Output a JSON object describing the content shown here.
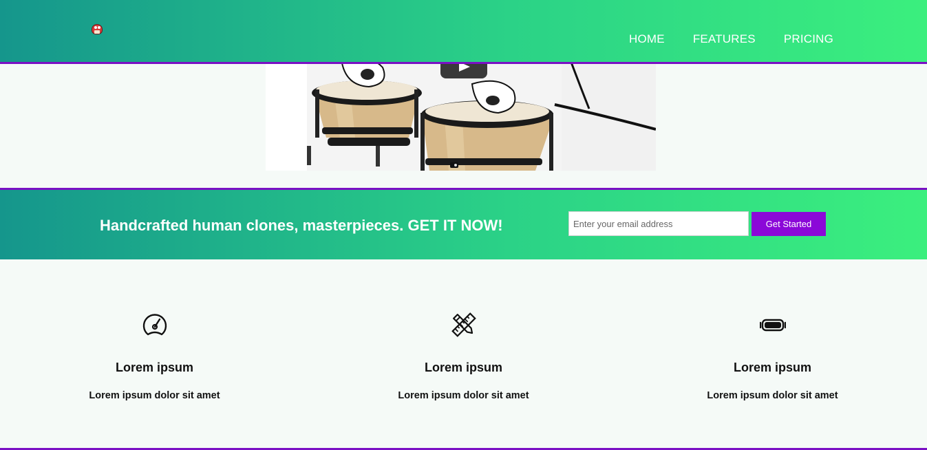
{
  "header": {
    "logo_icon": "mushroom-logo-icon",
    "nav": [
      {
        "label": "HOME"
      },
      {
        "label": "FEATURES"
      },
      {
        "label": "PRICING"
      }
    ]
  },
  "video": {
    "play_icon": "play-icon",
    "content": "bongo-drums-image"
  },
  "cta": {
    "headline": "Handcrafted human clones, masterpieces. GET IT NOW!",
    "email_placeholder": "Enter your email address",
    "button_label": "Get Started"
  },
  "features": [
    {
      "icon": "speedometer-icon",
      "title": "Lorem ipsum",
      "text": "Lorem ipsum dolor sit amet"
    },
    {
      "icon": "ruler-pencil-icon",
      "title": "Lorem ipsum",
      "text": "Lorem ipsum dolor sit amet"
    },
    {
      "icon": "vr-goggles-icon",
      "title": "Lorem ipsum",
      "text": "Lorem ipsum dolor sit amet"
    }
  ],
  "colors": {
    "gradient_start": "#15968c",
    "gradient_end": "#3bef7e",
    "accent_purple": "#8b08d8"
  }
}
